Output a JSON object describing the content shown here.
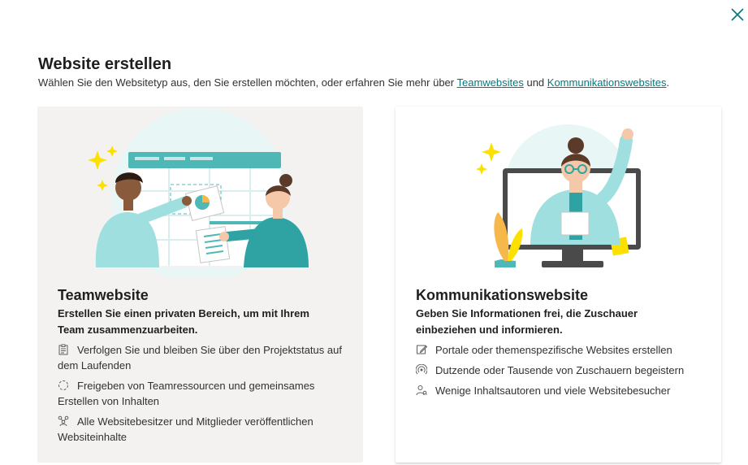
{
  "dialog": {
    "title": "Website erstellen",
    "subtitle_pre": "Wählen Sie den Websitetyp aus, den Sie erstellen möchten, oder erfahren Sie mehr über ",
    "link_team": "Teamwebsites",
    "subtitle_mid": " und ",
    "link_comm": "Kommunikationswebsites",
    "subtitle_post": "."
  },
  "team_card": {
    "title": "Teamwebsite",
    "description": "Erstellen Sie einen privaten Bereich, um mit Ihrem Team zusammenzuarbeiten.",
    "features": [
      {
        "icon": "clipboard-icon",
        "text": "Verfolgen Sie und bleiben Sie über den Projektstatus auf dem Laufenden"
      },
      {
        "icon": "sync-circle-icon",
        "text": "Freigeben von Teamressourcen und gemeinsames Erstellen von Inhalten"
      },
      {
        "icon": "people-network-icon",
        "text": "Alle Websitebesitzer und Mitglieder veröffentlichen Websiteinhalte"
      }
    ]
  },
  "comm_card": {
    "title": "Kommunikationswebsite",
    "description": "Geben Sie Informationen frei, die Zuschauer einbeziehen und informieren.",
    "features": [
      {
        "icon": "edit-page-icon",
        "text": "Portale oder themenspezifische Websites erstellen"
      },
      {
        "icon": "broadcast-icon",
        "text": "Dutzende oder Tausende von Zuschauern begeistern"
      },
      {
        "icon": "person-view-icon",
        "text": "Wenige Inhaltsautoren und viele Websitebesucher"
      }
    ]
  },
  "colors": {
    "accent_teal": "#03787c",
    "card_selected_bg": "#f3f2f1"
  }
}
